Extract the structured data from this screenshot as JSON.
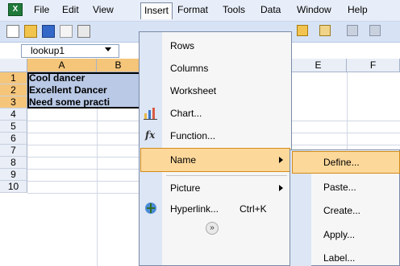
{
  "menubar": {
    "items": [
      {
        "label": "File"
      },
      {
        "label": "Edit"
      },
      {
        "label": "View"
      },
      {
        "label": "Insert"
      },
      {
        "label": "Format"
      },
      {
        "label": "Tools"
      },
      {
        "label": "Data"
      },
      {
        "label": "Window"
      },
      {
        "label": "Help"
      }
    ]
  },
  "namebox": {
    "value": "lookup1"
  },
  "grid": {
    "columns": [
      "A",
      "B",
      "E",
      "F"
    ],
    "rows": [
      "1",
      "2",
      "3",
      "4",
      "5",
      "6",
      "7",
      "8",
      "9",
      "10"
    ],
    "cells": [
      "Cool dancer",
      "Excellent Dancer",
      "Need some practi"
    ]
  },
  "insert_menu": {
    "items": [
      {
        "label": "Rows"
      },
      {
        "label": "Columns"
      },
      {
        "label": "Worksheet"
      },
      {
        "label": "Chart..."
      },
      {
        "label": "Function..."
      },
      {
        "label": "Name"
      },
      {
        "label": "Picture"
      },
      {
        "label": "Hyperlink..."
      }
    ],
    "hyperlink_shortcut": "Ctrl+K"
  },
  "name_submenu": {
    "items": [
      {
        "label": "Define..."
      },
      {
        "label": "Paste..."
      },
      {
        "label": "Create..."
      },
      {
        "label": "Apply..."
      },
      {
        "label": "Label..."
      }
    ]
  },
  "colors": {
    "highlight": "#fcd89a",
    "selection": "#b9c9e6",
    "header_selected": "#f5c57a"
  }
}
